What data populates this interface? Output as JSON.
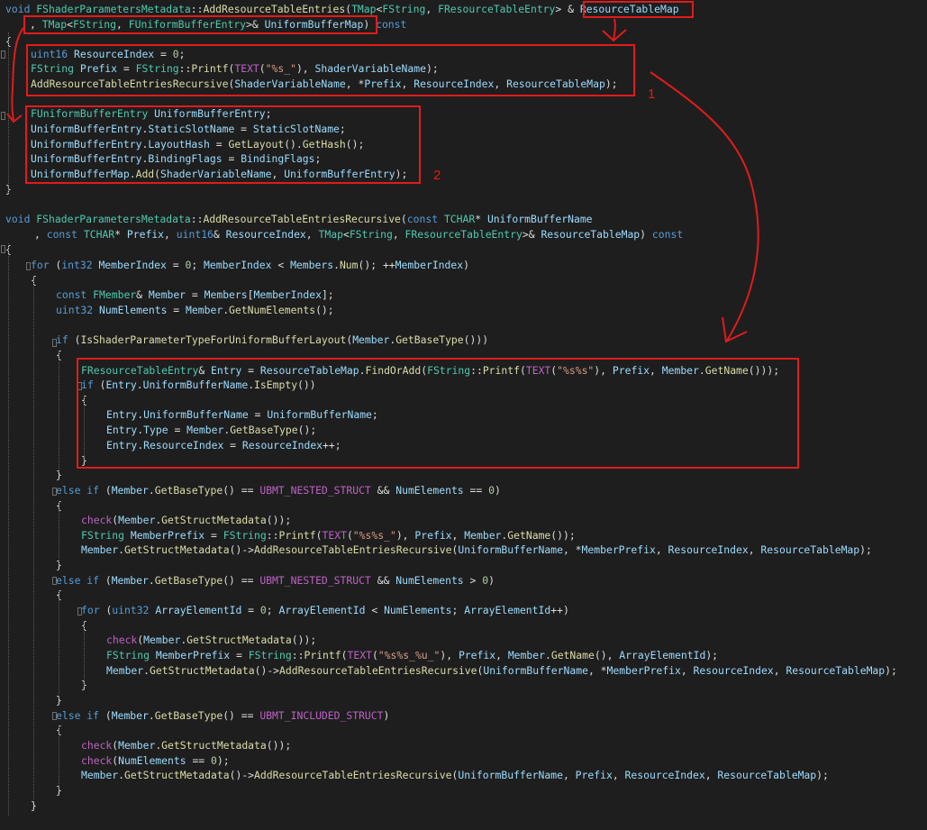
{
  "annotations": {
    "number_1": "1",
    "number_2": "2",
    "color": "#e11b1b"
  },
  "code_lines": [
    [
      [
        "kw",
        "void "
      ],
      [
        "ty",
        "FShaderParametersMetadata"
      ],
      [
        "pl",
        "::"
      ],
      [
        "fn",
        "AddResourceTableEntries"
      ],
      [
        "pl",
        "("
      ],
      [
        "ty",
        "TMap"
      ],
      [
        "pl",
        "<"
      ],
      [
        "ty",
        "FString"
      ],
      [
        "pl",
        ", "
      ],
      [
        "ty",
        "FResourceTableEntry"
      ],
      [
        "pl",
        "> & "
      ],
      [
        "va",
        "ResourceTableMap"
      ]
    ],
    [
      [
        "pl",
        ", "
      ],
      [
        "ty",
        "TMap"
      ],
      [
        "pl",
        "<"
      ],
      [
        "ty",
        "FString"
      ],
      [
        "pl",
        ", "
      ],
      [
        "ty",
        "FUniformBufferEntry"
      ],
      [
        "pl",
        ">& "
      ],
      [
        "va",
        "UniformBufferMap"
      ],
      [
        "pl",
        ") "
      ],
      [
        "kw",
        "const"
      ]
    ],
    [
      [
        "pl",
        "{"
      ]
    ],
    [
      [
        "kw",
        "uint16 "
      ],
      [
        "va",
        "ResourceIndex"
      ],
      [
        "pl",
        " = "
      ],
      [
        "nu",
        "0"
      ],
      [
        "pl",
        ";"
      ]
    ],
    [
      [
        "ty",
        "FString "
      ],
      [
        "va",
        "Prefix"
      ],
      [
        "pl",
        " = "
      ],
      [
        "ty",
        "FString"
      ],
      [
        "pl",
        "::"
      ],
      [
        "fn",
        "Printf"
      ],
      [
        "pl",
        "("
      ],
      [
        "mc",
        "TEXT"
      ],
      [
        "pl",
        "("
      ],
      [
        "st",
        "\"%s_\""
      ],
      [
        "pl",
        "), "
      ],
      [
        "va",
        "ShaderVariableName"
      ],
      [
        "pl",
        ");"
      ]
    ],
    [
      [
        "fn",
        "AddResourceTableEntriesRecursive"
      ],
      [
        "pl",
        "("
      ],
      [
        "va",
        "ShaderVariableName"
      ],
      [
        "pl",
        ", *"
      ],
      [
        "va",
        "Prefix"
      ],
      [
        "pl",
        ", "
      ],
      [
        "va",
        "ResourceIndex"
      ],
      [
        "pl",
        ", "
      ],
      [
        "va",
        "ResourceTableMap"
      ],
      [
        "pl",
        ");"
      ]
    ],
    [],
    [
      [
        "ty",
        "FUniformBufferEntry "
      ],
      [
        "va",
        "UniformBufferEntry"
      ],
      [
        "pl",
        ";"
      ]
    ],
    [
      [
        "va",
        "UniformBufferEntry"
      ],
      [
        "pl",
        "."
      ],
      [
        "va",
        "StaticSlotName"
      ],
      [
        "pl",
        " = "
      ],
      [
        "va",
        "StaticSlotName"
      ],
      [
        "pl",
        ";"
      ]
    ],
    [
      [
        "va",
        "UniformBufferEntry"
      ],
      [
        "pl",
        "."
      ],
      [
        "va",
        "LayoutHash"
      ],
      [
        "pl",
        " = "
      ],
      [
        "fn",
        "GetLayout"
      ],
      [
        "pl",
        "()."
      ],
      [
        "fn",
        "GetHash"
      ],
      [
        "pl",
        "();"
      ]
    ],
    [
      [
        "va",
        "UniformBufferEntry"
      ],
      [
        "pl",
        "."
      ],
      [
        "va",
        "BindingFlags"
      ],
      [
        "pl",
        " = "
      ],
      [
        "va",
        "BindingFlags"
      ],
      [
        "pl",
        ";"
      ]
    ],
    [
      [
        "va",
        "UniformBufferMap"
      ],
      [
        "pl",
        "."
      ],
      [
        "fn",
        "Add"
      ],
      [
        "pl",
        "("
      ],
      [
        "va",
        "ShaderVariableName"
      ],
      [
        "pl",
        ", "
      ],
      [
        "va",
        "UniformBufferEntry"
      ],
      [
        "pl",
        ");"
      ]
    ],
    [
      [
        "pl",
        "}"
      ]
    ],
    [],
    [
      [
        "kw",
        "void "
      ],
      [
        "ty",
        "FShaderParametersMetadata"
      ],
      [
        "pl",
        "::"
      ],
      [
        "fn",
        "AddResourceTableEntriesRecursive"
      ],
      [
        "pl",
        "("
      ],
      [
        "kw",
        "const "
      ],
      [
        "ty",
        "TCHAR"
      ],
      [
        "pl",
        "* "
      ],
      [
        "va",
        "UniformBufferName"
      ]
    ],
    [
      [
        "pl",
        ", "
      ],
      [
        "kw",
        "const "
      ],
      [
        "ty",
        "TCHAR"
      ],
      [
        "pl",
        "* "
      ],
      [
        "va",
        "Prefix"
      ],
      [
        "pl",
        ", "
      ],
      [
        "kw",
        "uint16"
      ],
      [
        "pl",
        "& "
      ],
      [
        "va",
        "ResourceIndex"
      ],
      [
        "pl",
        ", "
      ],
      [
        "ty",
        "TMap"
      ],
      [
        "pl",
        "<"
      ],
      [
        "ty",
        "FString"
      ],
      [
        "pl",
        ", "
      ],
      [
        "ty",
        "FResourceTableEntry"
      ],
      [
        "pl",
        ">& "
      ],
      [
        "va",
        "ResourceTableMap"
      ],
      [
        "pl",
        ") "
      ],
      [
        "kw",
        "const"
      ]
    ],
    [
      [
        "pl",
        "{"
      ]
    ],
    [
      [
        "kw",
        "for "
      ],
      [
        "pl",
        "("
      ],
      [
        "kw",
        "int32 "
      ],
      [
        "va",
        "MemberIndex"
      ],
      [
        "pl",
        " = "
      ],
      [
        "nu",
        "0"
      ],
      [
        "pl",
        "; "
      ],
      [
        "va",
        "MemberIndex"
      ],
      [
        "pl",
        " < "
      ],
      [
        "va",
        "Members"
      ],
      [
        "pl",
        "."
      ],
      [
        "fn",
        "Num"
      ],
      [
        "pl",
        "(); ++"
      ],
      [
        "va",
        "MemberIndex"
      ],
      [
        "pl",
        ")"
      ]
    ],
    [
      [
        "pl",
        "{"
      ]
    ],
    [
      [
        "kw",
        "const "
      ],
      [
        "ty",
        "FMember"
      ],
      [
        "pl",
        "& "
      ],
      [
        "va",
        "Member"
      ],
      [
        "pl",
        " = "
      ],
      [
        "va",
        "Members"
      ],
      [
        "pl",
        "["
      ],
      [
        "va",
        "MemberIndex"
      ],
      [
        "pl",
        "];"
      ]
    ],
    [
      [
        "kw",
        "uint32 "
      ],
      [
        "va",
        "NumElements"
      ],
      [
        "pl",
        " = "
      ],
      [
        "va",
        "Member"
      ],
      [
        "pl",
        "."
      ],
      [
        "fn",
        "GetNumElements"
      ],
      [
        "pl",
        "();"
      ]
    ],
    [],
    [
      [
        "kw",
        "if "
      ],
      [
        "pl",
        "("
      ],
      [
        "fn",
        "IsShaderParameterTypeForUniformBufferLayout"
      ],
      [
        "pl",
        "("
      ],
      [
        "va",
        "Member"
      ],
      [
        "pl",
        "."
      ],
      [
        "fn",
        "GetBaseType"
      ],
      [
        "pl",
        "()))"
      ]
    ],
    [
      [
        "pl",
        "{"
      ]
    ],
    [
      [
        "ty",
        "FResourceTableEntry"
      ],
      [
        "pl",
        "& "
      ],
      [
        "va",
        "Entry"
      ],
      [
        "pl",
        " = "
      ],
      [
        "va",
        "ResourceTableMap"
      ],
      [
        "pl",
        "."
      ],
      [
        "fn",
        "FindOrAdd"
      ],
      [
        "pl",
        "("
      ],
      [
        "ty",
        "FString"
      ],
      [
        "pl",
        "::"
      ],
      [
        "fn",
        "Printf"
      ],
      [
        "pl",
        "("
      ],
      [
        "mc",
        "TEXT"
      ],
      [
        "pl",
        "("
      ],
      [
        "st",
        "\"%s%s\""
      ],
      [
        "pl",
        "), "
      ],
      [
        "va",
        "Prefix"
      ],
      [
        "pl",
        ", "
      ],
      [
        "va",
        "Member"
      ],
      [
        "pl",
        "."
      ],
      [
        "fn",
        "GetName"
      ],
      [
        "pl",
        "()));"
      ]
    ],
    [
      [
        "kw",
        "if "
      ],
      [
        "pl",
        "("
      ],
      [
        "va",
        "Entry"
      ],
      [
        "pl",
        "."
      ],
      [
        "va",
        "UniformBufferName"
      ],
      [
        "pl",
        "."
      ],
      [
        "fn",
        "IsEmpty"
      ],
      [
        "pl",
        "())"
      ]
    ],
    [
      [
        "pl",
        "{"
      ]
    ],
    [
      [
        "va",
        "Entry"
      ],
      [
        "pl",
        "."
      ],
      [
        "va",
        "UniformBufferName"
      ],
      [
        "pl",
        " = "
      ],
      [
        "va",
        "UniformBufferName"
      ],
      [
        "pl",
        ";"
      ]
    ],
    [
      [
        "va",
        "Entry"
      ],
      [
        "pl",
        "."
      ],
      [
        "va",
        "Type"
      ],
      [
        "pl",
        " = "
      ],
      [
        "va",
        "Member"
      ],
      [
        "pl",
        "."
      ],
      [
        "fn",
        "GetBaseType"
      ],
      [
        "pl",
        "();"
      ]
    ],
    [
      [
        "va",
        "Entry"
      ],
      [
        "pl",
        "."
      ],
      [
        "va",
        "ResourceIndex"
      ],
      [
        "pl",
        " = "
      ],
      [
        "va",
        "ResourceIndex"
      ],
      [
        "pl",
        "++;"
      ]
    ],
    [
      [
        "pl",
        "}"
      ]
    ],
    [
      [
        "pl",
        "}"
      ]
    ],
    [
      [
        "kw",
        "else if "
      ],
      [
        "pl",
        "("
      ],
      [
        "va",
        "Member"
      ],
      [
        "pl",
        "."
      ],
      [
        "fn",
        "GetBaseType"
      ],
      [
        "pl",
        "() == "
      ],
      [
        "mc",
        "UBMT_NESTED_STRUCT"
      ],
      [
        "pl",
        " && "
      ],
      [
        "va",
        "NumElements"
      ],
      [
        "pl",
        " == "
      ],
      [
        "nu",
        "0"
      ],
      [
        "pl",
        ")"
      ]
    ],
    [
      [
        "pl",
        "{"
      ]
    ],
    [
      [
        "mc",
        "check"
      ],
      [
        "pl",
        "("
      ],
      [
        "va",
        "Member"
      ],
      [
        "pl",
        "."
      ],
      [
        "fn",
        "GetStructMetadata"
      ],
      [
        "pl",
        "());"
      ]
    ],
    [
      [
        "ty",
        "FString "
      ],
      [
        "va",
        "MemberPrefix"
      ],
      [
        "pl",
        " = "
      ],
      [
        "ty",
        "FString"
      ],
      [
        "pl",
        "::"
      ],
      [
        "fn",
        "Printf"
      ],
      [
        "pl",
        "("
      ],
      [
        "mc",
        "TEXT"
      ],
      [
        "pl",
        "("
      ],
      [
        "st",
        "\"%s%s_\""
      ],
      [
        "pl",
        "), "
      ],
      [
        "va",
        "Prefix"
      ],
      [
        "pl",
        ", "
      ],
      [
        "va",
        "Member"
      ],
      [
        "pl",
        "."
      ],
      [
        "fn",
        "GetName"
      ],
      [
        "pl",
        "());"
      ]
    ],
    [
      [
        "va",
        "Member"
      ],
      [
        "pl",
        "."
      ],
      [
        "fn",
        "GetStructMetadata"
      ],
      [
        "pl",
        "()->"
      ],
      [
        "fn",
        "AddResourceTableEntriesRecursive"
      ],
      [
        "pl",
        "("
      ],
      [
        "va",
        "UniformBufferName"
      ],
      [
        "pl",
        ", *"
      ],
      [
        "va",
        "MemberPrefix"
      ],
      [
        "pl",
        ", "
      ],
      [
        "va",
        "ResourceIndex"
      ],
      [
        "pl",
        ", "
      ],
      [
        "va",
        "ResourceTableMap"
      ],
      [
        "pl",
        ");"
      ]
    ],
    [
      [
        "pl",
        "}"
      ]
    ],
    [
      [
        "kw",
        "else if "
      ],
      [
        "pl",
        "("
      ],
      [
        "va",
        "Member"
      ],
      [
        "pl",
        "."
      ],
      [
        "fn",
        "GetBaseType"
      ],
      [
        "pl",
        "() == "
      ],
      [
        "mc",
        "UBMT_NESTED_STRUCT"
      ],
      [
        "pl",
        " && "
      ],
      [
        "va",
        "NumElements"
      ],
      [
        "pl",
        " > "
      ],
      [
        "nu",
        "0"
      ],
      [
        "pl",
        ")"
      ]
    ],
    [
      [
        "pl",
        "{"
      ]
    ],
    [
      [
        "kw",
        "for "
      ],
      [
        "pl",
        "("
      ],
      [
        "kw",
        "uint32 "
      ],
      [
        "va",
        "ArrayElementId"
      ],
      [
        "pl",
        " = "
      ],
      [
        "nu",
        "0"
      ],
      [
        "pl",
        "; "
      ],
      [
        "va",
        "ArrayElementId"
      ],
      [
        "pl",
        " < "
      ],
      [
        "va",
        "NumElements"
      ],
      [
        "pl",
        "; "
      ],
      [
        "va",
        "ArrayElementId"
      ],
      [
        "pl",
        "++)"
      ]
    ],
    [
      [
        "pl",
        "{"
      ]
    ],
    [
      [
        "mc",
        "check"
      ],
      [
        "pl",
        "("
      ],
      [
        "va",
        "Member"
      ],
      [
        "pl",
        "."
      ],
      [
        "fn",
        "GetStructMetadata"
      ],
      [
        "pl",
        "());"
      ]
    ],
    [
      [
        "ty",
        "FString "
      ],
      [
        "va",
        "MemberPrefix"
      ],
      [
        "pl",
        " = "
      ],
      [
        "ty",
        "FString"
      ],
      [
        "pl",
        "::"
      ],
      [
        "fn",
        "Printf"
      ],
      [
        "pl",
        "("
      ],
      [
        "mc",
        "TEXT"
      ],
      [
        "pl",
        "("
      ],
      [
        "st",
        "\"%s%s_%u_\""
      ],
      [
        "pl",
        "), "
      ],
      [
        "va",
        "Prefix"
      ],
      [
        "pl",
        ", "
      ],
      [
        "va",
        "Member"
      ],
      [
        "pl",
        "."
      ],
      [
        "fn",
        "GetName"
      ],
      [
        "pl",
        "(), "
      ],
      [
        "va",
        "ArrayElementId"
      ],
      [
        "pl",
        ");"
      ]
    ],
    [
      [
        "va",
        "Member"
      ],
      [
        "pl",
        "."
      ],
      [
        "fn",
        "GetStructMetadata"
      ],
      [
        "pl",
        "()->"
      ],
      [
        "fn",
        "AddResourceTableEntriesRecursive"
      ],
      [
        "pl",
        "("
      ],
      [
        "va",
        "UniformBufferName"
      ],
      [
        "pl",
        ", *"
      ],
      [
        "va",
        "MemberPrefix"
      ],
      [
        "pl",
        ", "
      ],
      [
        "va",
        "ResourceIndex"
      ],
      [
        "pl",
        ", "
      ],
      [
        "va",
        "ResourceTableMap"
      ],
      [
        "pl",
        ");"
      ]
    ],
    [
      [
        "pl",
        "}"
      ]
    ],
    [
      [
        "pl",
        "}"
      ]
    ],
    [
      [
        "kw",
        "else if "
      ],
      [
        "pl",
        "("
      ],
      [
        "va",
        "Member"
      ],
      [
        "pl",
        "."
      ],
      [
        "fn",
        "GetBaseType"
      ],
      [
        "pl",
        "() == "
      ],
      [
        "mc",
        "UBMT_INCLUDED_STRUCT"
      ],
      [
        "pl",
        ")"
      ]
    ],
    [
      [
        "pl",
        "{"
      ]
    ],
    [
      [
        "mc",
        "check"
      ],
      [
        "pl",
        "("
      ],
      [
        "va",
        "Member"
      ],
      [
        "pl",
        "."
      ],
      [
        "fn",
        "GetStructMetadata"
      ],
      [
        "pl",
        "());"
      ]
    ],
    [
      [
        "mc",
        "check"
      ],
      [
        "pl",
        "("
      ],
      [
        "va",
        "NumElements"
      ],
      [
        "pl",
        " == "
      ],
      [
        "nu",
        "0"
      ],
      [
        "pl",
        ");"
      ]
    ],
    [
      [
        "va",
        "Member"
      ],
      [
        "pl",
        "."
      ],
      [
        "fn",
        "GetStructMetadata"
      ],
      [
        "pl",
        "()->"
      ],
      [
        "fn",
        "AddResourceTableEntriesRecursive"
      ],
      [
        "pl",
        "("
      ],
      [
        "va",
        "UniformBufferName"
      ],
      [
        "pl",
        ", "
      ],
      [
        "va",
        "Prefix"
      ],
      [
        "pl",
        ", "
      ],
      [
        "va",
        "ResourceIndex"
      ],
      [
        "pl",
        ", "
      ],
      [
        "va",
        "ResourceTableMap"
      ],
      [
        "pl",
        ");"
      ]
    ],
    [
      [
        "pl",
        "}"
      ]
    ],
    [
      [
        "pl",
        "}"
      ]
    ]
  ]
}
